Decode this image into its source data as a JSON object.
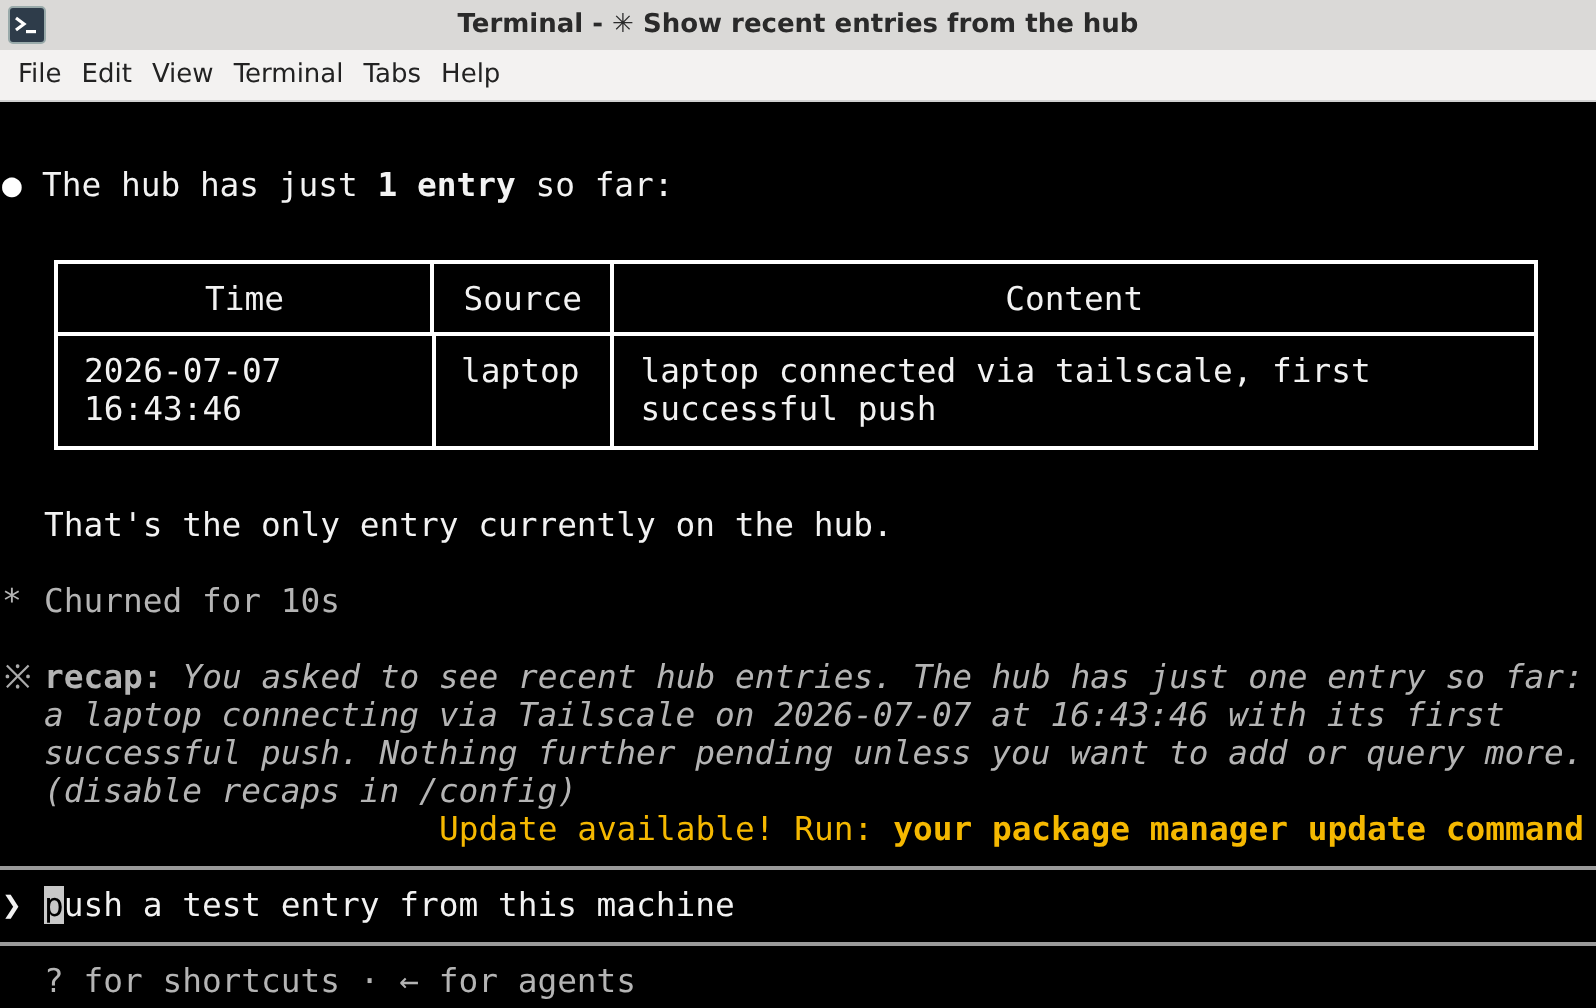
{
  "window": {
    "title": "Terminal - ✳ Show recent entries from the hub"
  },
  "menu": [
    "File",
    "Edit",
    "View",
    "Terminal",
    "Tabs",
    "Help"
  ],
  "terminal": {
    "message": {
      "bullet": "●",
      "text": "The hub has just **1 entry** so far:"
    },
    "table": {
      "columns": [
        "Time",
        "Source",
        "Content"
      ],
      "rows": [
        {
          "cells": [
            [
              "2026-07-07",
              "16:43:46"
            ],
            [
              "laptop"
            ],
            [
              "laptop connected via tailscale, first",
              "successful push"
            ]
          ]
        }
      ]
    },
    "note": "That's the only entry currently on the hub.",
    "status": {
      "icon": "*",
      "text": "Churned for 10s"
    },
    "recap": {
      "icon": "※",
      "label": "recap:",
      "lines": [
        "You asked to see recent hub entries. The hub has just one entry so far:",
        "a laptop connecting via Tailscale on 2026-07-07 at 16:43:46 with its first",
        "successful push. Nothing further pending unless you want to add or query more.",
        "(disable recaps in /config)"
      ]
    },
    "update": {
      "prefix": "Update available! Run:",
      "command": "your package manager update command"
    },
    "prompt": {
      "symbol": "❯",
      "value": "push a test entry from this machine"
    },
    "footer": "? for shortcuts · ← for agents"
  }
}
